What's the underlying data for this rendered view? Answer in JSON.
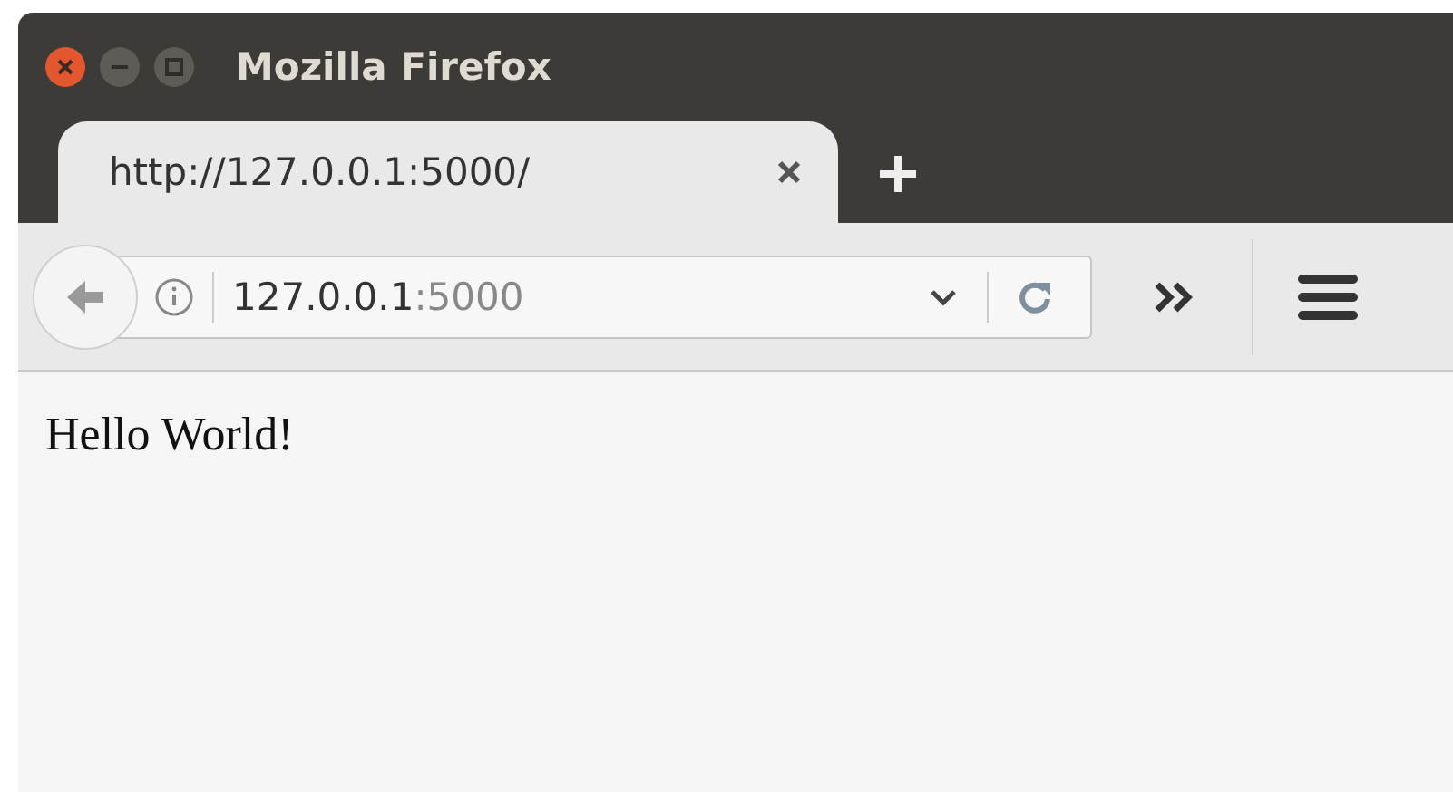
{
  "window": {
    "title": "Mozilla Firefox"
  },
  "tabs": [
    {
      "label": "http://127.0.0.1:5000/",
      "selected": true
    }
  ],
  "address_bar": {
    "host": "127.0.0.1",
    "port": ":5000"
  },
  "page": {
    "text": "Hello World!"
  }
}
